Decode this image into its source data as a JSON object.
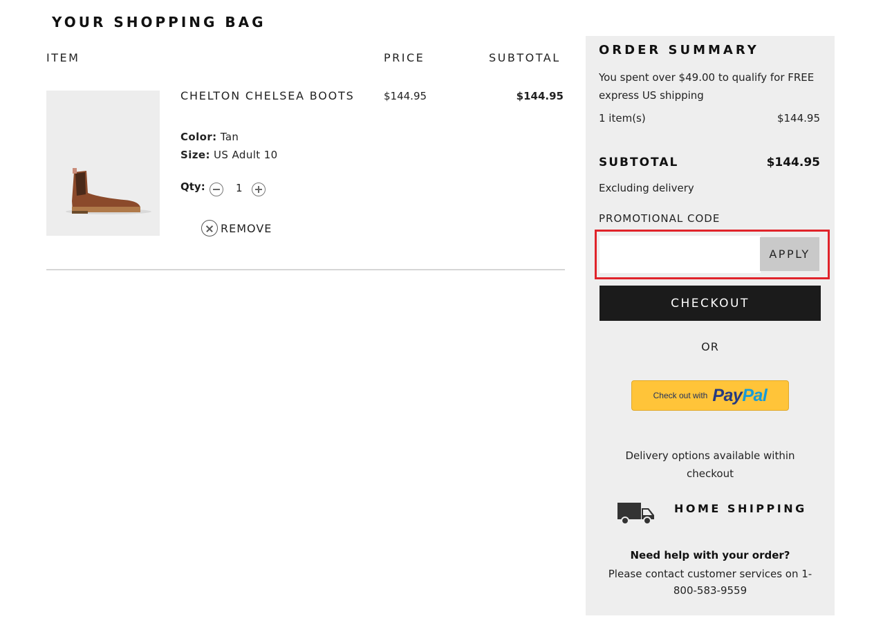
{
  "page": {
    "title": "YOUR SHOPPING BAG"
  },
  "columns": {
    "item": "ITEM",
    "price": "PRICE",
    "subtotal": "SUBTOTAL"
  },
  "cart": {
    "items": [
      {
        "name": "CHELTON CHELSEA BOOTS",
        "color_label": "Color:",
        "color": "Tan",
        "size_label": "Size:",
        "size": "US Adult 10",
        "qty_label": "Qty:",
        "qty": "1",
        "price": "$144.95",
        "subtotal": "$144.95",
        "remove_label": "REMOVE",
        "image_icon": "chelsea-boot-image"
      }
    ]
  },
  "summary": {
    "title": "ORDER SUMMARY",
    "shipping_note": "You spent over $49.00 to qualify for FREE express US shipping",
    "items_count": "1 item(s)",
    "items_total": "$144.95",
    "subtotal_label": "SUBTOTAL",
    "subtotal_value": "$144.95",
    "excluding": "Excluding delivery",
    "promo_label": "PROMOTIONAL CODE",
    "promo_value": "",
    "apply_label": "APPLY",
    "checkout_label": "CHECKOUT",
    "or_label": "OR",
    "paypal_small": "Check out with",
    "paypal_pay": "Pay",
    "paypal_pal": "Pal",
    "delivery_note": "Delivery options available within checkout",
    "home_shipping": "HOME SHIPPING",
    "help_title": "Need help with your order?",
    "help_text": "Please contact customer services on 1-800-583-9559"
  },
  "colors": {
    "highlight": "#e0232a",
    "checkout_bg": "#1b1b1b",
    "paypal_yellow": "#ffc439",
    "summary_bg": "#eeeeee"
  }
}
